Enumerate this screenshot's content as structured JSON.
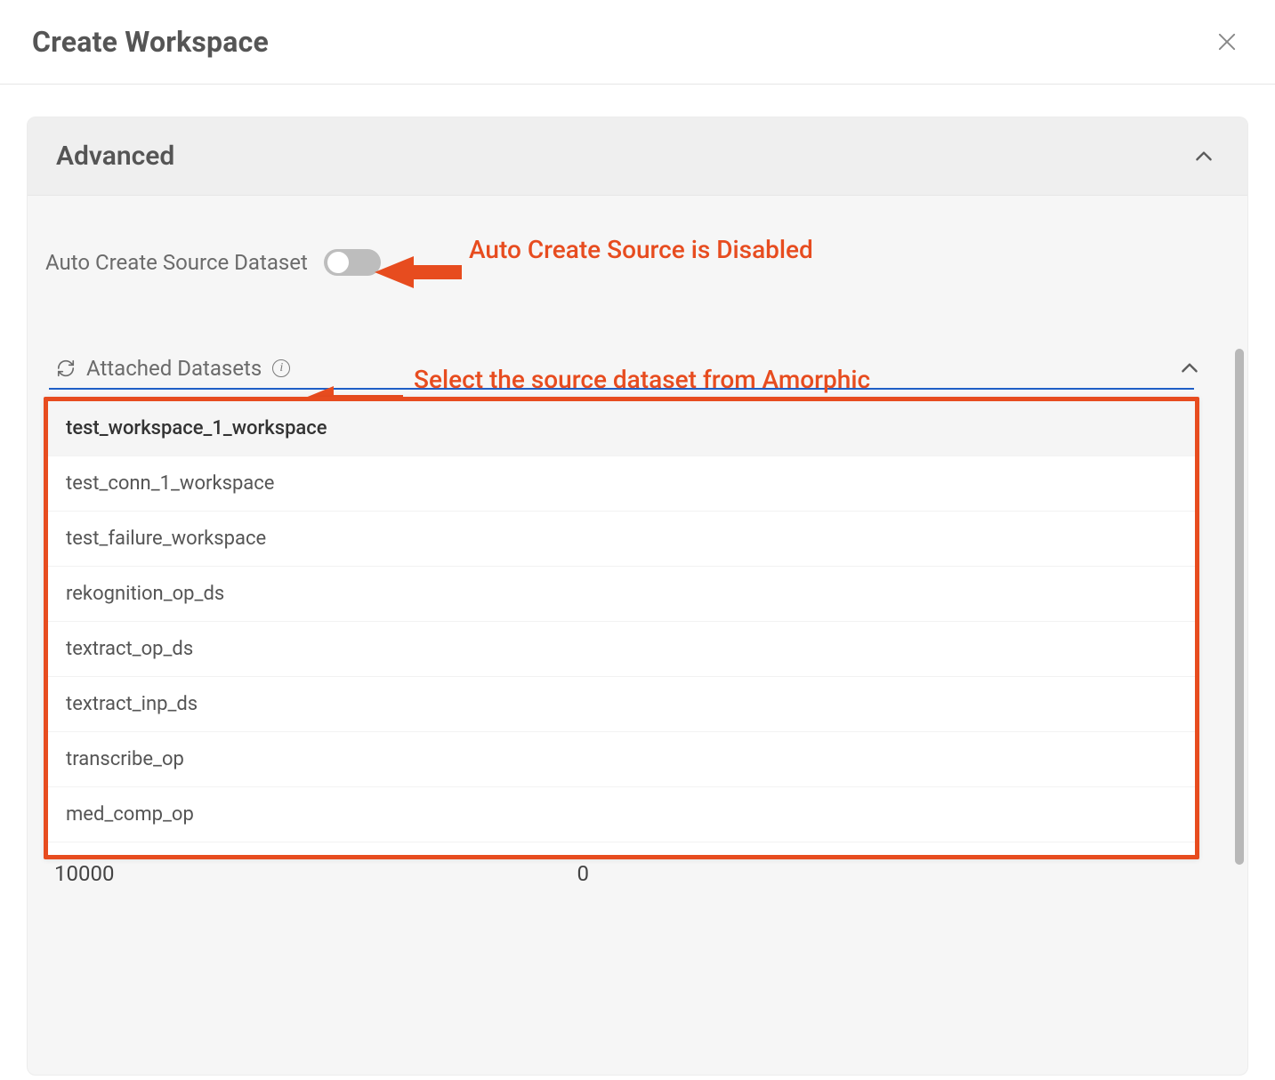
{
  "modal": {
    "title": "Create Workspace"
  },
  "section": {
    "title": "Advanced",
    "auto_create_label": "Auto Create Source Dataset",
    "auto_create_enabled": false,
    "attached_label": "Attached Datasets"
  },
  "annotations": {
    "auto_create": "Auto Create Source is Disabled",
    "select_source": "Select the source dataset from Amorphic"
  },
  "datasets": [
    "test_workspace_1_workspace",
    "test_conn_1_workspace",
    "test_failure_workspace",
    "rekognition_op_ds",
    "textract_op_ds",
    "textract_inp_ds",
    "transcribe_op",
    "med_comp_op"
  ],
  "footer_values": {
    "left": "10000",
    "right": "0"
  }
}
